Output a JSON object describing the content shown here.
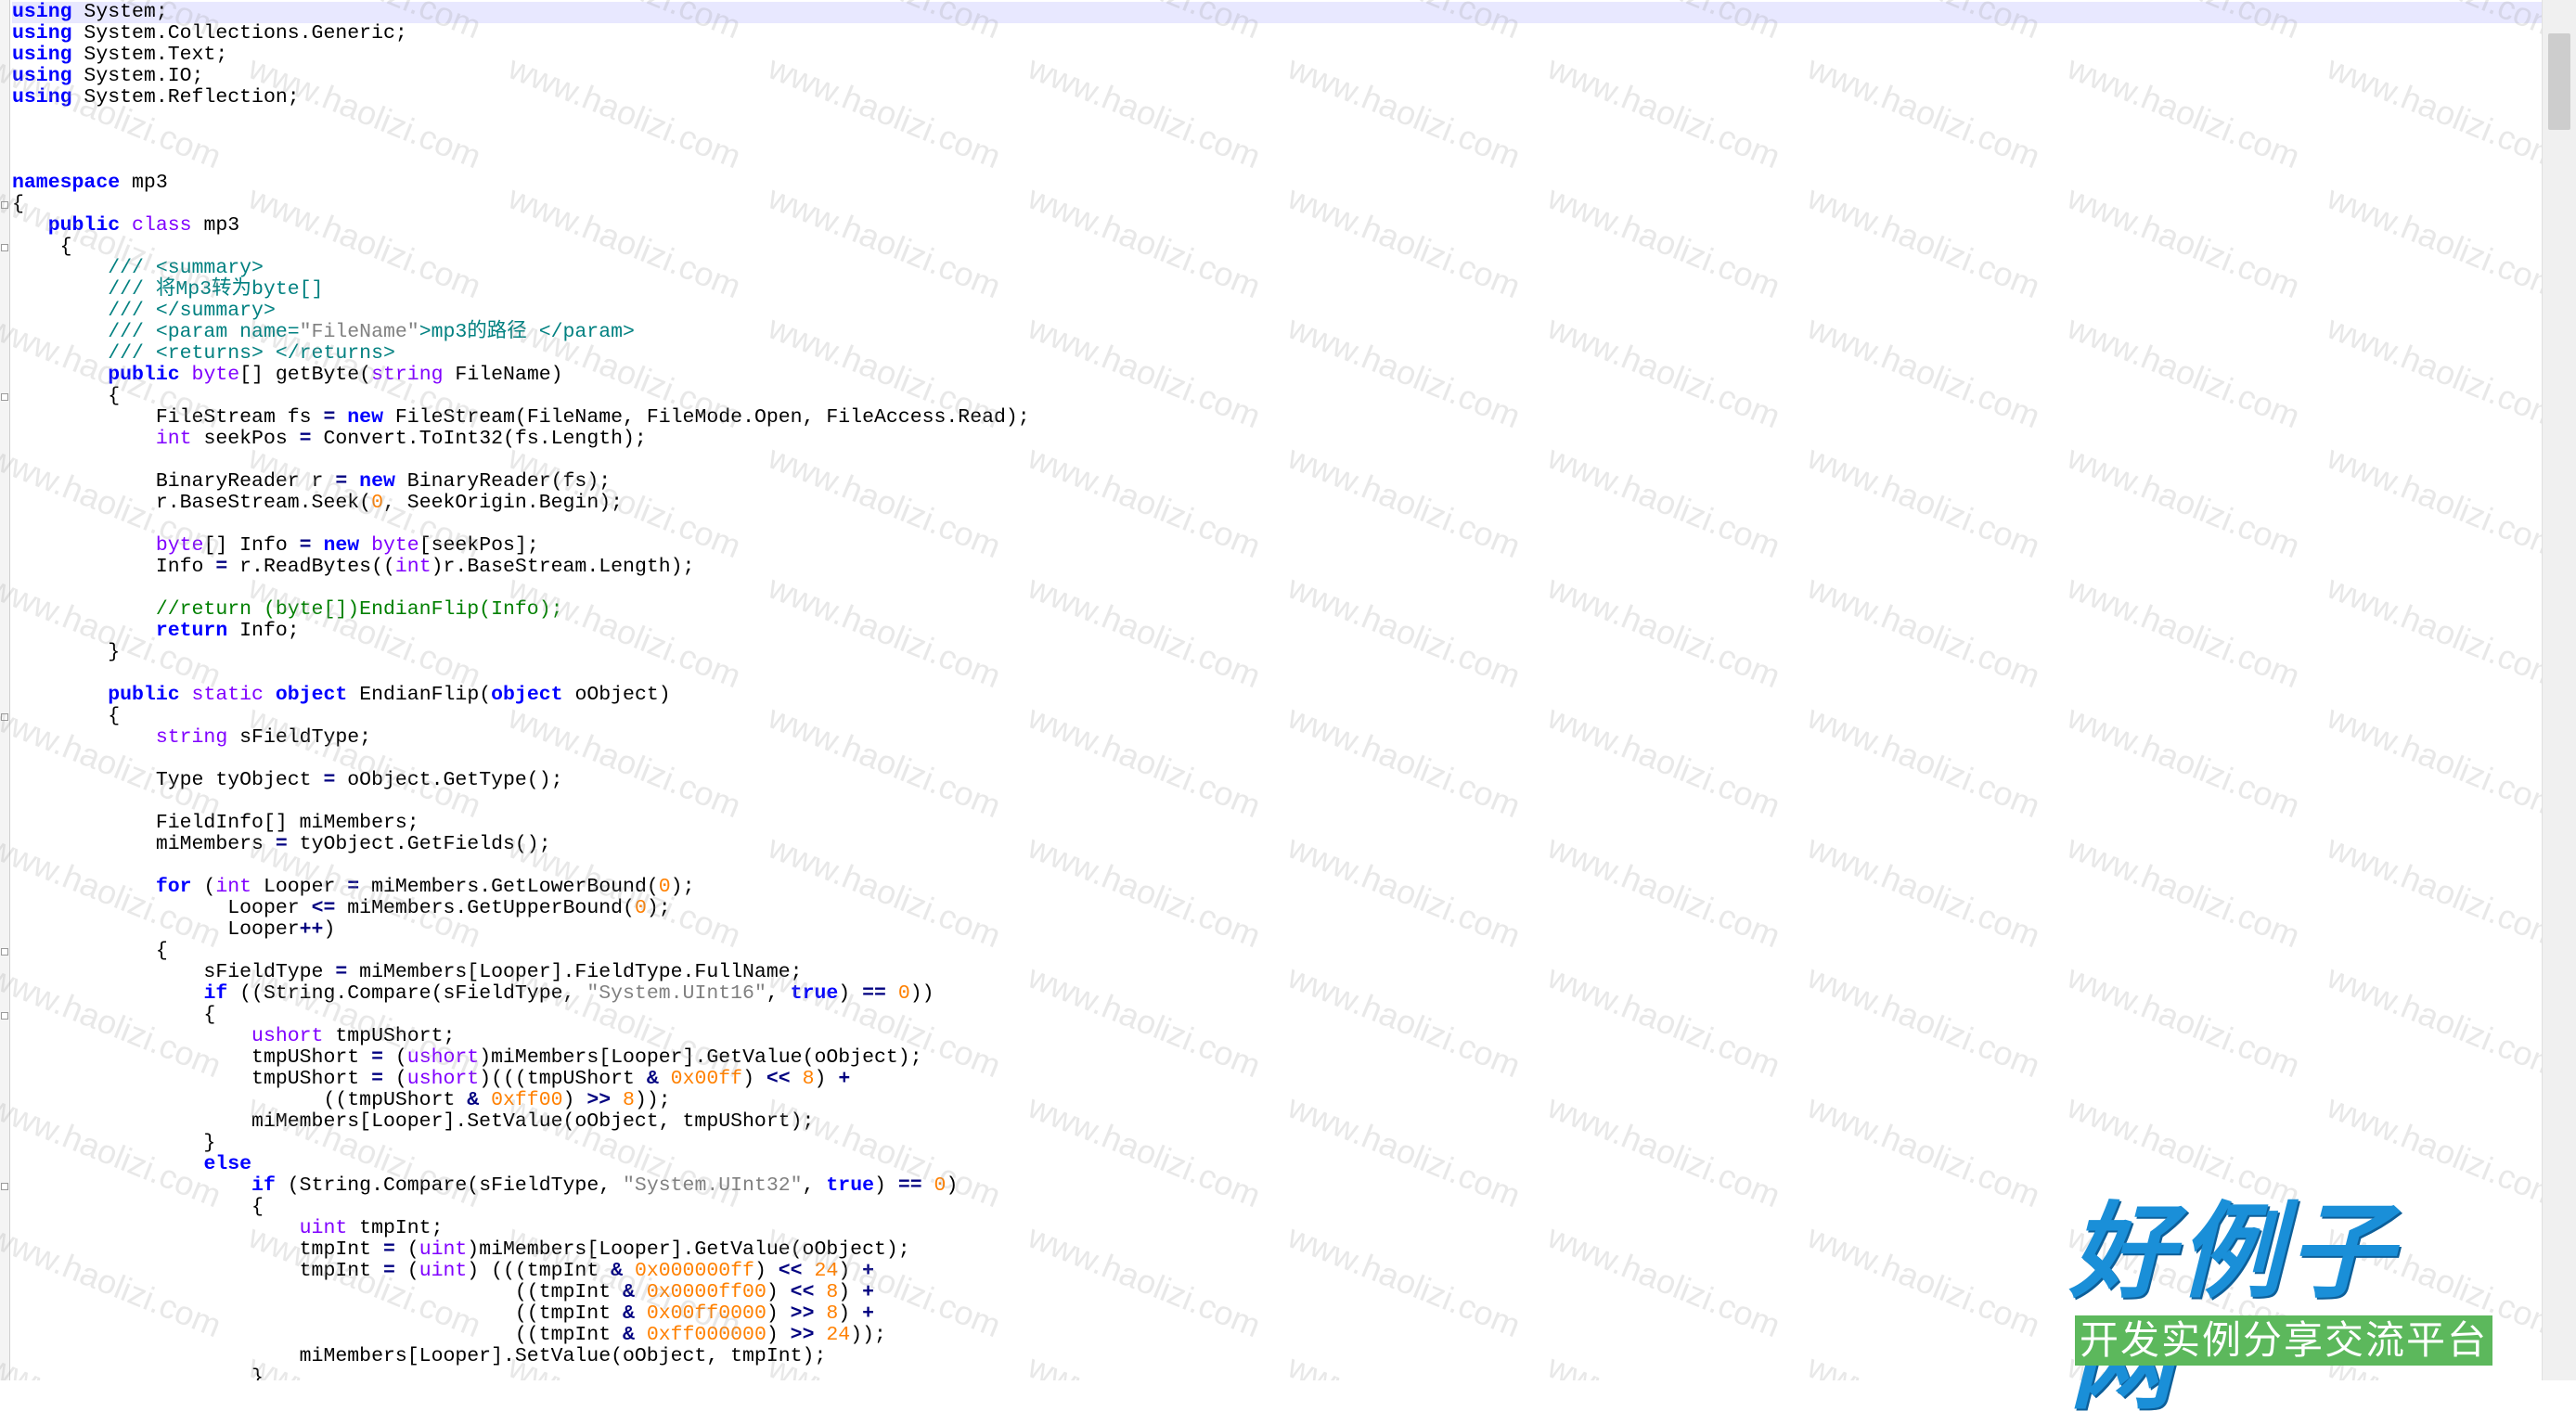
{
  "code_lines": [
    [
      {
        "t": "using",
        "c": "kw"
      },
      {
        "t": " System;"
      }
    ],
    [
      {
        "t": "using",
        "c": "kw"
      },
      {
        "t": " System.Collections.Generic;"
      }
    ],
    [
      {
        "t": "using",
        "c": "kw"
      },
      {
        "t": " System.Text;"
      }
    ],
    [
      {
        "t": "using",
        "c": "kw"
      },
      {
        "t": " System.IO;"
      }
    ],
    [
      {
        "t": "using",
        "c": "kw"
      },
      {
        "t": " System.Reflection;"
      }
    ],
    [],
    [],
    [],
    [
      {
        "t": "namespace",
        "c": "kw"
      },
      {
        "t": " mp3"
      }
    ],
    [
      {
        "t": "{"
      }
    ],
    [
      {
        "t": "   "
      },
      {
        "t": "public",
        "c": "kw"
      },
      {
        "t": " "
      },
      {
        "t": "class",
        "c": "ty"
      },
      {
        "t": " mp3"
      }
    ],
    [
      {
        "t": "    {"
      }
    ],
    [
      {
        "t": "        /// <summary>",
        "c": "doc"
      }
    ],
    [
      {
        "t": "        /// 将Mp3转为byte[]",
        "c": "doc"
      }
    ],
    [
      {
        "t": "        /// </summary>",
        "c": "doc"
      }
    ],
    [
      {
        "t": "        /// <param name=",
        "c": "doc"
      },
      {
        "t": "\"FileName\"",
        "c": "str"
      },
      {
        "t": ">mp3的路径 </param>",
        "c": "doc"
      }
    ],
    [
      {
        "t": "        /// <returns> </returns>",
        "c": "doc"
      }
    ],
    [
      {
        "t": "        "
      },
      {
        "t": "public",
        "c": "kw"
      },
      {
        "t": " "
      },
      {
        "t": "byte",
        "c": "ty"
      },
      {
        "t": "[] getByte("
      },
      {
        "t": "string",
        "c": "ty"
      },
      {
        "t": " FileName)"
      }
    ],
    [
      {
        "t": "        {"
      }
    ],
    [
      {
        "t": "            FileStream fs "
      },
      {
        "t": "=",
        "c": "op"
      },
      {
        "t": " "
      },
      {
        "t": "new",
        "c": "kw"
      },
      {
        "t": " FileStream(FileName, FileMode.Open, FileAccess.Read);"
      }
    ],
    [
      {
        "t": "            "
      },
      {
        "t": "int",
        "c": "ty"
      },
      {
        "t": " seekPos "
      },
      {
        "t": "=",
        "c": "op"
      },
      {
        "t": " Convert.ToInt32(fs.Length);"
      }
    ],
    [],
    [
      {
        "t": "            BinaryReader r "
      },
      {
        "t": "=",
        "c": "op"
      },
      {
        "t": " "
      },
      {
        "t": "new",
        "c": "kw"
      },
      {
        "t": " BinaryReader(fs);"
      }
    ],
    [
      {
        "t": "            r.BaseStream.Seek("
      },
      {
        "t": "0",
        "c": "num"
      },
      {
        "t": ", SeekOrigin.Begin);"
      }
    ],
    [],
    [
      {
        "t": "            "
      },
      {
        "t": "byte",
        "c": "ty"
      },
      {
        "t": "[] Info "
      },
      {
        "t": "=",
        "c": "op"
      },
      {
        "t": " "
      },
      {
        "t": "new",
        "c": "kw"
      },
      {
        "t": " "
      },
      {
        "t": "byte",
        "c": "ty"
      },
      {
        "t": "[seekPos];"
      }
    ],
    [
      {
        "t": "            Info "
      },
      {
        "t": "=",
        "c": "op"
      },
      {
        "t": " r.ReadBytes(("
      },
      {
        "t": "int",
        "c": "ty"
      },
      {
        "t": ")r.BaseStream.Length);"
      }
    ],
    [],
    [
      {
        "t": "            //return (byte[])EndianFlip(Info);",
        "c": "cm"
      }
    ],
    [
      {
        "t": "            "
      },
      {
        "t": "return",
        "c": "kw"
      },
      {
        "t": " Info;"
      }
    ],
    [
      {
        "t": "        }"
      }
    ],
    [],
    [
      {
        "t": "        "
      },
      {
        "t": "public",
        "c": "kw"
      },
      {
        "t": " "
      },
      {
        "t": "static",
        "c": "ty"
      },
      {
        "t": " "
      },
      {
        "t": "object",
        "c": "kw"
      },
      {
        "t": " EndianFlip("
      },
      {
        "t": "object",
        "c": "kw"
      },
      {
        "t": " oObject)"
      }
    ],
    [
      {
        "t": "        {"
      }
    ],
    [
      {
        "t": "            "
      },
      {
        "t": "string",
        "c": "ty"
      },
      {
        "t": " sFieldType;"
      }
    ],
    [],
    [
      {
        "t": "            Type tyObject "
      },
      {
        "t": "=",
        "c": "op"
      },
      {
        "t": " oObject.GetType();"
      }
    ],
    [],
    [
      {
        "t": "            FieldInfo[] miMembers;"
      }
    ],
    [
      {
        "t": "            miMembers "
      },
      {
        "t": "=",
        "c": "op"
      },
      {
        "t": " tyObject.GetFields();"
      }
    ],
    [],
    [
      {
        "t": "            "
      },
      {
        "t": "for",
        "c": "kw"
      },
      {
        "t": " ("
      },
      {
        "t": "int",
        "c": "ty"
      },
      {
        "t": " Looper "
      },
      {
        "t": "=",
        "c": "op"
      },
      {
        "t": " miMembers.GetLowerBound("
      },
      {
        "t": "0",
        "c": "num"
      },
      {
        "t": ");"
      }
    ],
    [
      {
        "t": "                  Looper "
      },
      {
        "t": "<=",
        "c": "op"
      },
      {
        "t": " miMembers.GetUpperBound("
      },
      {
        "t": "0",
        "c": "num"
      },
      {
        "t": ");"
      }
    ],
    [
      {
        "t": "                  Looper"
      },
      {
        "t": "++",
        "c": "op"
      },
      {
        "t": ")"
      }
    ],
    [
      {
        "t": "            {"
      }
    ],
    [
      {
        "t": "                sFieldType "
      },
      {
        "t": "=",
        "c": "op"
      },
      {
        "t": " miMembers[Looper].FieldType.FullName;"
      }
    ],
    [
      {
        "t": "                "
      },
      {
        "t": "if",
        "c": "kw"
      },
      {
        "t": " ((String.Compare(sFieldType, "
      },
      {
        "t": "\"System.UInt16\"",
        "c": "str"
      },
      {
        "t": ", "
      },
      {
        "t": "true",
        "c": "kw"
      },
      {
        "t": ") "
      },
      {
        "t": "==",
        "c": "op"
      },
      {
        "t": " "
      },
      {
        "t": "0",
        "c": "num"
      },
      {
        "t": "))"
      }
    ],
    [
      {
        "t": "                {"
      }
    ],
    [
      {
        "t": "                    "
      },
      {
        "t": "ushort",
        "c": "ty"
      },
      {
        "t": " tmpUShort;"
      }
    ],
    [
      {
        "t": "                    tmpUShort "
      },
      {
        "t": "=",
        "c": "op"
      },
      {
        "t": " ("
      },
      {
        "t": "ushort",
        "c": "ty"
      },
      {
        "t": ")miMembers[Looper].GetValue(oObject);"
      }
    ],
    [
      {
        "t": "                    tmpUShort "
      },
      {
        "t": "=",
        "c": "op"
      },
      {
        "t": " ("
      },
      {
        "t": "ushort",
        "c": "ty"
      },
      {
        "t": ")(((tmpUShort "
      },
      {
        "t": "&",
        "c": "op"
      },
      {
        "t": " "
      },
      {
        "t": "0x00ff",
        "c": "num"
      },
      {
        "t": ") "
      },
      {
        "t": "<<",
        "c": "op"
      },
      {
        "t": " "
      },
      {
        "t": "8",
        "c": "num"
      },
      {
        "t": ") "
      },
      {
        "t": "+",
        "c": "op"
      }
    ],
    [
      {
        "t": "                          ((tmpUShort "
      },
      {
        "t": "&",
        "c": "op"
      },
      {
        "t": " "
      },
      {
        "t": "0xff00",
        "c": "num"
      },
      {
        "t": ") "
      },
      {
        "t": ">>",
        "c": "op"
      },
      {
        "t": " "
      },
      {
        "t": "8",
        "c": "num"
      },
      {
        "t": "));"
      }
    ],
    [
      {
        "t": "                    miMembers[Looper].SetValue(oObject, tmpUShort);"
      }
    ],
    [
      {
        "t": "                }"
      }
    ],
    [
      {
        "t": "                "
      },
      {
        "t": "else",
        "c": "kw"
      }
    ],
    [
      {
        "t": "                    "
      },
      {
        "t": "if",
        "c": "kw"
      },
      {
        "t": " (String.Compare(sFieldType, "
      },
      {
        "t": "\"System.UInt32\"",
        "c": "str"
      },
      {
        "t": ", "
      },
      {
        "t": "true",
        "c": "kw"
      },
      {
        "t": ") "
      },
      {
        "t": "==",
        "c": "op"
      },
      {
        "t": " "
      },
      {
        "t": "0",
        "c": "num"
      },
      {
        "t": ")"
      }
    ],
    [
      {
        "t": "                    {"
      }
    ],
    [
      {
        "t": "                        "
      },
      {
        "t": "uint",
        "c": "ty"
      },
      {
        "t": " tmpInt;"
      }
    ],
    [
      {
        "t": "                        tmpInt "
      },
      {
        "t": "=",
        "c": "op"
      },
      {
        "t": " ("
      },
      {
        "t": "uint",
        "c": "ty"
      },
      {
        "t": ")miMembers[Looper].GetValue(oObject);"
      }
    ],
    [
      {
        "t": "                        tmpInt "
      },
      {
        "t": "=",
        "c": "op"
      },
      {
        "t": " ("
      },
      {
        "t": "uint",
        "c": "ty"
      },
      {
        "t": ") (((tmpInt "
      },
      {
        "t": "&",
        "c": "op"
      },
      {
        "t": " "
      },
      {
        "t": "0x000000ff",
        "c": "num"
      },
      {
        "t": ") "
      },
      {
        "t": "<<",
        "c": "op"
      },
      {
        "t": " "
      },
      {
        "t": "24",
        "c": "num"
      },
      {
        "t": ") "
      },
      {
        "t": "+",
        "c": "op"
      }
    ],
    [
      {
        "t": "                                          ((tmpInt "
      },
      {
        "t": "&",
        "c": "op"
      },
      {
        "t": " "
      },
      {
        "t": "0x0000ff00",
        "c": "num"
      },
      {
        "t": ") "
      },
      {
        "t": "<<",
        "c": "op"
      },
      {
        "t": " "
      },
      {
        "t": "8",
        "c": "num"
      },
      {
        "t": ") "
      },
      {
        "t": "+",
        "c": "op"
      }
    ],
    [
      {
        "t": "                                          ((tmpInt "
      },
      {
        "t": "&",
        "c": "op"
      },
      {
        "t": " "
      },
      {
        "t": "0x00ff0000",
        "c": "num"
      },
      {
        "t": ") "
      },
      {
        "t": ">>",
        "c": "op"
      },
      {
        "t": " "
      },
      {
        "t": "8",
        "c": "num"
      },
      {
        "t": ") "
      },
      {
        "t": "+",
        "c": "op"
      }
    ],
    [
      {
        "t": "                                          ((tmpInt "
      },
      {
        "t": "&",
        "c": "op"
      },
      {
        "t": " "
      },
      {
        "t": "0xff000000",
        "c": "num"
      },
      {
        "t": ") "
      },
      {
        "t": ">>",
        "c": "op"
      },
      {
        "t": " "
      },
      {
        "t": "24",
        "c": "num"
      },
      {
        "t": "));"
      }
    ],
    [
      {
        "t": "                        miMembers[Looper].SetValue(oObject, tmpInt);"
      }
    ],
    [
      {
        "t": "                    }"
      }
    ]
  ],
  "watermark_text": "www.haolizi.com",
  "logo": {
    "title": "好例子网",
    "subtitle": "开发实例分享交流平台"
  },
  "colors": {
    "keyword": "#0000ff",
    "type": "#8000ff",
    "number": "#ff8000",
    "string": "#808080",
    "comment": "#008000",
    "doc_comment": "#008080",
    "operator": "#000080",
    "logo_blue": "#1a8fd8",
    "logo_green": "#5cb85c"
  }
}
